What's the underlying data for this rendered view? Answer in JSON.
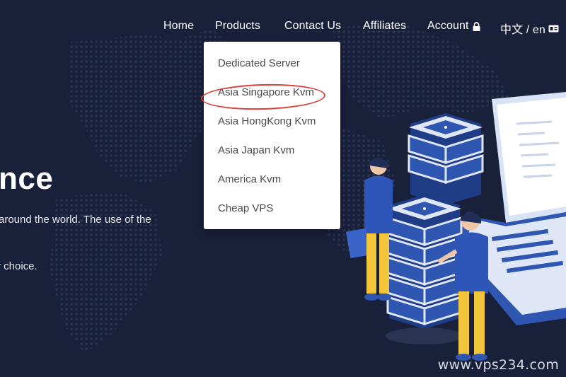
{
  "nav": {
    "home": "Home",
    "products": "Products",
    "contact": "Contact Us",
    "affiliates": "Affiliates",
    "account": "Account",
    "language": "中文 / en"
  },
  "dropdown": {
    "items": [
      "Dedicated Server",
      "Asia Singapore Kvm",
      "Asia HongKong Kvm",
      "Asia Japan Kvm",
      "America Kvm",
      "Cheap VPS"
    ],
    "highlighted_index": 1
  },
  "hero": {
    "title_fragment": "nce",
    "line1_fragment": "around the world. The use of the",
    "line2_fragment": "r choice."
  },
  "watermark": "www.vps234.com",
  "colors": {
    "background": "#19203a",
    "highlight": "#d9403a",
    "server_blue": "#2f56b0",
    "shirt_blue": "#2e55b8",
    "pants_yellow": "#f2c53d"
  },
  "icons": {
    "account": "lock-icon",
    "language": "language-card-icon"
  }
}
